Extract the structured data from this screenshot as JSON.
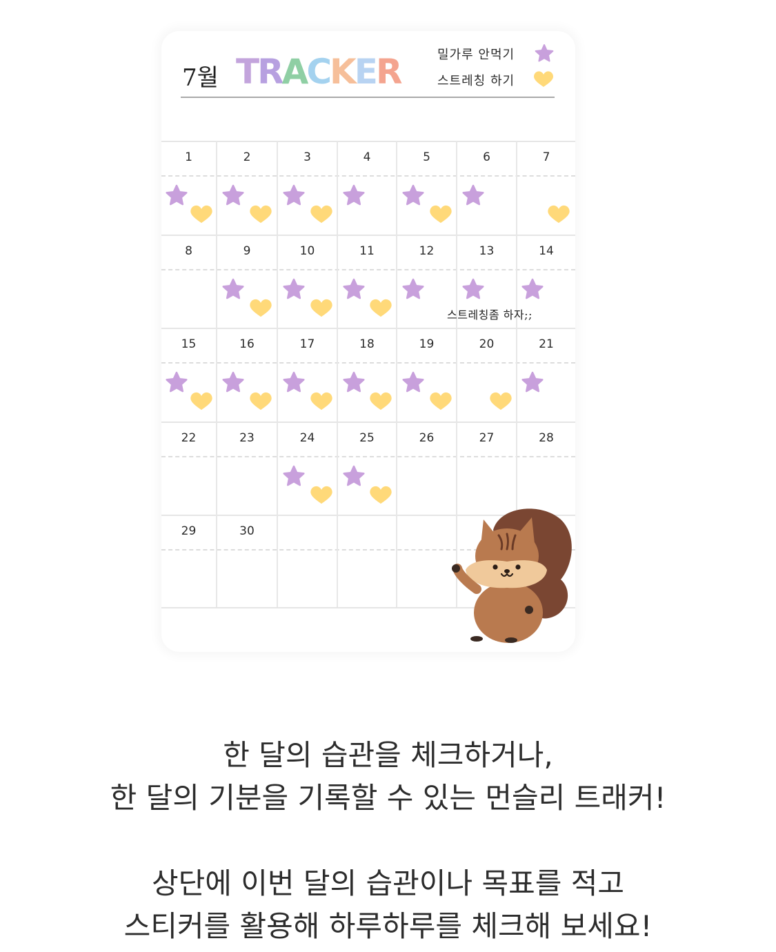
{
  "tracker": {
    "month_label": "7월",
    "title_letters": [
      {
        "char": "T",
        "color": "#c3a4dc"
      },
      {
        "char": "R",
        "color": "#b7a0e0"
      },
      {
        "char": "A",
        "color": "#8fcfa4"
      },
      {
        "char": "C",
        "color": "#a4d2ef"
      },
      {
        "char": "K",
        "color": "#f6bf9a"
      },
      {
        "char": "E",
        "color": "#b8d3f2"
      },
      {
        "char": "R",
        "color": "#f4a48f"
      }
    ],
    "legend": [
      {
        "text": "밀가루 안먹기",
        "icon": "star-icon",
        "color": "#c8a0dc"
      },
      {
        "text": "스트레칭 하기",
        "icon": "heart-icon",
        "color": "#ffd979"
      }
    ],
    "weeks": [
      [
        {
          "day": "1",
          "star": true,
          "heart": true
        },
        {
          "day": "2",
          "star": true,
          "heart": true
        },
        {
          "day": "3",
          "star": true,
          "heart": true
        },
        {
          "day": "4",
          "star": true,
          "heart": false
        },
        {
          "day": "5",
          "star": true,
          "heart": true
        },
        {
          "day": "6",
          "star": true,
          "heart": false
        },
        {
          "day": "7",
          "star": false,
          "heart": true
        }
      ],
      [
        {
          "day": "8",
          "star": false,
          "heart": false
        },
        {
          "day": "9",
          "star": true,
          "heart": true
        },
        {
          "day": "10",
          "star": true,
          "heart": true
        },
        {
          "day": "11",
          "star": true,
          "heart": true
        },
        {
          "day": "12",
          "star": true,
          "heart": false
        },
        {
          "day": "13",
          "star": true,
          "heart": false
        },
        {
          "day": "14",
          "star": true,
          "heart": false
        }
      ],
      [
        {
          "day": "15",
          "star": true,
          "heart": true
        },
        {
          "day": "16",
          "star": true,
          "heart": true
        },
        {
          "day": "17",
          "star": true,
          "heart": true
        },
        {
          "day": "18",
          "star": true,
          "heart": true
        },
        {
          "day": "19",
          "star": true,
          "heart": true
        },
        {
          "day": "20",
          "star": false,
          "heart": true
        },
        {
          "day": "21",
          "star": true,
          "heart": false
        }
      ],
      [
        {
          "day": "22",
          "star": false,
          "heart": false
        },
        {
          "day": "23",
          "star": false,
          "heart": false
        },
        {
          "day": "24",
          "star": true,
          "heart": true
        },
        {
          "day": "25",
          "star": true,
          "heart": true
        },
        {
          "day": "26",
          "star": false,
          "heart": false
        },
        {
          "day": "27",
          "star": false,
          "heart": false
        },
        {
          "day": "28",
          "star": false,
          "heart": false
        }
      ],
      [
        {
          "day": "29",
          "star": false,
          "heart": false
        },
        {
          "day": "30",
          "star": false,
          "heart": false
        },
        {
          "day": "",
          "star": false,
          "heart": false
        },
        {
          "day": "",
          "star": false,
          "heart": false
        },
        {
          "day": "",
          "star": false,
          "heart": false
        },
        {
          "day": "",
          "star": false,
          "heart": false
        },
        {
          "day": "",
          "star": false,
          "heart": false
        }
      ]
    ],
    "note": "스트레칭좀 하자;;",
    "mascot": "squirrel-illustration"
  },
  "caption": {
    "line1": "한 달의 습관을 체크하거나,",
    "line2": "한 달의 기분을 기록할 수 있는 먼슬리 트래커!",
    "line3": "상단에 이번 달의 습관이나 목표를 적고",
    "line4": "스티커를 활용해 하루하루를 체크해 보세요!"
  },
  "colors": {
    "star": "#c8a0dc",
    "heart": "#ffd979",
    "squirrel_body": "#b97a4f",
    "squirrel_tail": "#7a4632",
    "squirrel_chest": "#f0c99b"
  }
}
